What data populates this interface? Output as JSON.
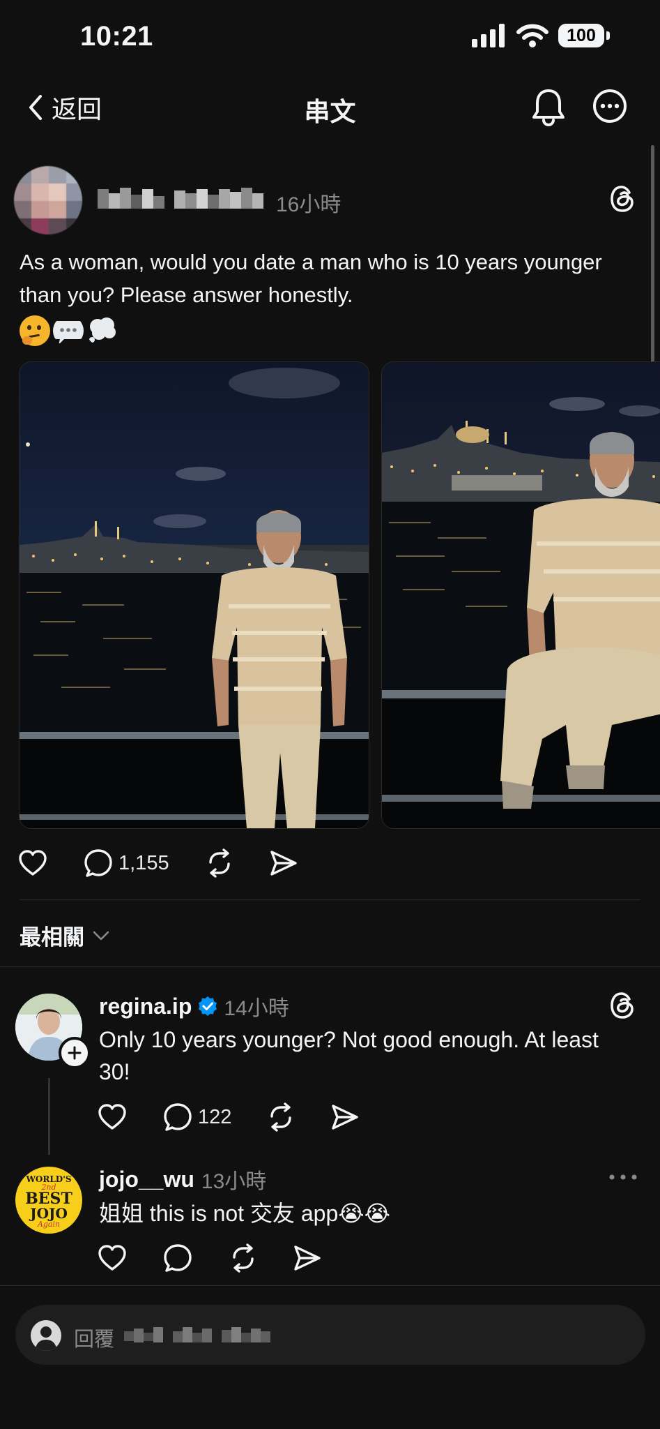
{
  "status_bar": {
    "time": "10:21",
    "battery": "100"
  },
  "nav": {
    "back_label": "返回",
    "title": "串文"
  },
  "post": {
    "time": "16小時",
    "text": "As a woman, would you date a man who is 10 years younger than you? Please answer honestly.",
    "emojis": [
      "thinking-face-emoji",
      "speech-balloon-emoji",
      "thought-balloon-emoji"
    ],
    "reply_count": "1,155",
    "photo_count": 2
  },
  "sort": {
    "label": "最相關"
  },
  "replies": [
    {
      "username": "regina.ip",
      "verified": true,
      "time": "14小時",
      "text": "Only 10 years younger? Not good enough. At least 30!",
      "reply_count": "122"
    },
    {
      "username": "jojo__wu",
      "time": "13小時",
      "text": "姐姐 this is not 交友 app😭😭",
      "avatar_text": [
        "WORLD'S",
        "2nd",
        "BEST",
        "JOJO",
        "Again"
      ]
    }
  ],
  "composer": {
    "placeholder": "回覆"
  },
  "colors": {
    "background": "#101010",
    "text": "#f3f5f7",
    "muted": "#8b8b8b",
    "verified": "#0095f6",
    "jojo_avatar": "#f7cf1b"
  }
}
